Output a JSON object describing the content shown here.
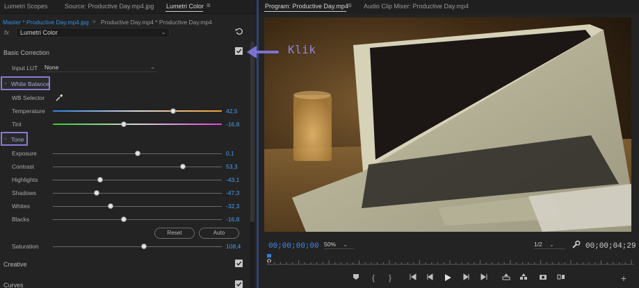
{
  "left_panel": {
    "tabs": [
      "Lumetri Scopes",
      "Source: Productive Day.mp4.jpg",
      "Lumetri Color"
    ],
    "breadcrumb_master": "Master * Productive Day.mp4.jpg",
    "breadcrumb_arrow": ">",
    "breadcrumb_clip": "Productive Day.mp4 * Productive Day.mp4",
    "fx_label": "fx",
    "effect_select": "Lumetri Color",
    "basic_correction": {
      "title": "Basic Correction",
      "enabled": true,
      "input_lut_label": "Input LUT",
      "input_lut_value": "None"
    },
    "white_balance": {
      "title": "White Balance",
      "selector_label": "WB Selector",
      "params": [
        {
          "label": "Temperature",
          "value": "42,5",
          "position": 0.71
        },
        {
          "label": "Tint",
          "value": "-16,8",
          "position": 0.42
        }
      ]
    },
    "tone": {
      "title": "Tone",
      "params": [
        {
          "label": "Exposure",
          "value": "0,1",
          "position": 0.5
        },
        {
          "label": "Contrast",
          "value": "53,3",
          "position": 0.77
        },
        {
          "label": "Highlights",
          "value": "-43,1",
          "position": 0.28
        },
        {
          "label": "Shadows",
          "value": "-47,3",
          "position": 0.26
        },
        {
          "label": "Whites",
          "value": "-32,3",
          "position": 0.34
        },
        {
          "label": "Blacks",
          "value": "-16,8",
          "position": 0.42
        }
      ],
      "reset_label": "Reset",
      "auto_label": "Auto"
    },
    "saturation": {
      "label": "Saturation",
      "value": "108,4",
      "position": 0.54
    },
    "creative": {
      "title": "Creative",
      "enabled": true
    },
    "curves": {
      "title": "Curves",
      "enabled": true
    }
  },
  "right_panel": {
    "tabs": [
      "Program: Productive Day.mp4",
      "Audio Clip Mixer: Productive Day.mp4"
    ],
    "current_timecode": "00;00;00;00",
    "zoom": "50%",
    "resolution": "1/2",
    "duration_timecode": "00;00;04;29"
  },
  "annotation": {
    "text": "Klik"
  },
  "colors": {
    "accent_blue": "#3d8fe6",
    "highlight_purple": "#8a7ad6",
    "annotation_text": "#8f88e0"
  }
}
